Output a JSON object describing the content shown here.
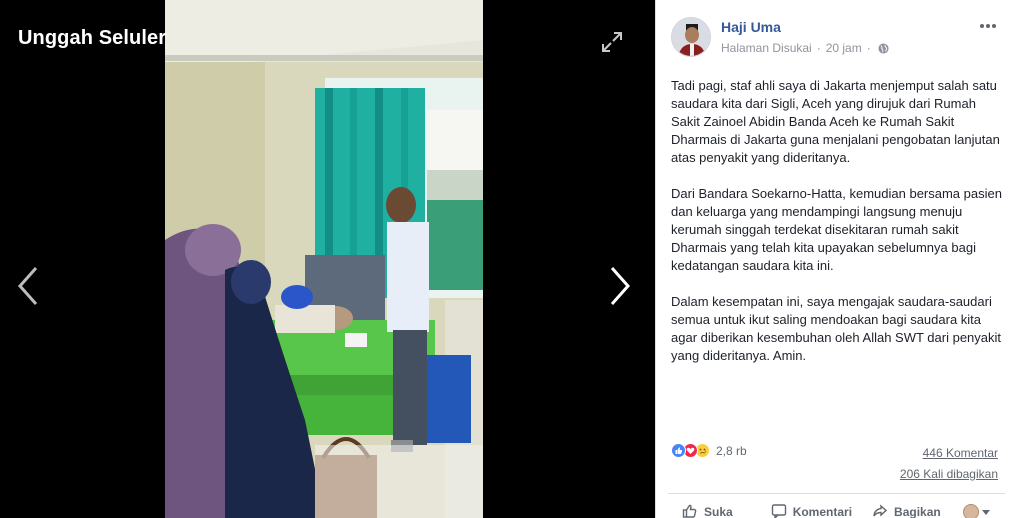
{
  "viewer": {
    "album_title": "Unggah Seluler",
    "icons": {
      "expand": "expand-icon",
      "prev": "chevron-left-icon",
      "next": "chevron-right-icon"
    }
  },
  "post": {
    "page_name": "Haji Uma",
    "page_status": "Halaman Disukai",
    "time": "20 jam",
    "privacy_icon": "globe-icon",
    "paragraphs": [
      "Tadi pagi, staf ahli saya di Jakarta menjemput salah satu saudara kita dari Sigli, Aceh yang dirujuk dari Rumah Sakit Zainoel Abidin Banda Aceh ke Rumah Sakit Dharmais di Jakarta guna menjalani pengobatan lanjutan atas penyakit yang dideritanya.",
      "Dari Bandara Soekarno-Hatta, kemudian bersama pasien dan keluarga yang mendampingi langsung menuju kerumah singgah terdekat disekitaran rumah sakit Dharmais yang telah kita upayakan sebelumnya bagi kedatangan saudara kita ini.",
      "Dalam kesempatan ini, saya mengajak saudara-saudari semua untuk ikut saling mendoakan bagi saudara kita agar diberikan kesembuhan oleh Allah SWT dari penyakit yang dideritanya. Amin."
    ]
  },
  "stats": {
    "reaction_count": "2,8 rb",
    "comments": "446 Komentar",
    "shares": "206 Kali dibagikan"
  },
  "actions": {
    "like": "Suka",
    "comment": "Komentari",
    "share": "Bagikan"
  },
  "colors": {
    "link_blue": "#365899",
    "meta_gray": "#90949c",
    "like_blue": "#4a84f5",
    "love_red": "#f0284a",
    "sad_yellow": "#fbcc3b"
  }
}
